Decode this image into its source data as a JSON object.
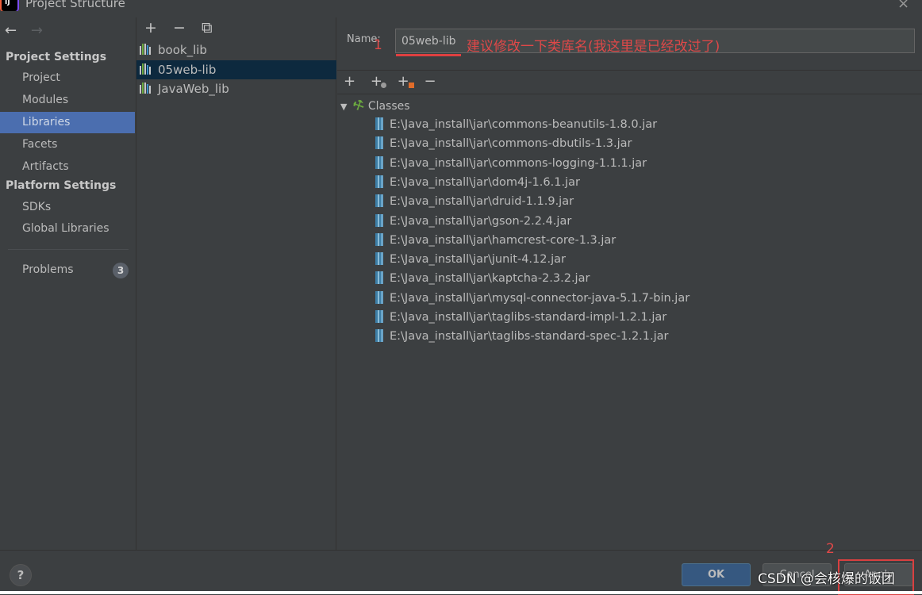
{
  "window": {
    "title": "Project Structure",
    "close_icon": "×"
  },
  "sidebar": {
    "back_icon": "←",
    "forward_icon": "→",
    "sections": [
      {
        "header": "Project Settings",
        "items": [
          "Project",
          "Modules",
          "Libraries",
          "Facets",
          "Artifacts"
        ]
      },
      {
        "header": "Platform Settings",
        "items": [
          "SDKs",
          "Global Libraries"
        ]
      }
    ],
    "selected": "Libraries",
    "problems": {
      "label": "Problems",
      "count": "3"
    }
  },
  "libraries": {
    "toolbar": {
      "add": "+",
      "remove": "−",
      "copy": "⧉"
    },
    "items": [
      "book_lib",
      "05web-lib",
      "JavaWeb_lib"
    ],
    "selected": "05web-lib"
  },
  "details": {
    "name_label": "Name:",
    "name_value": "05web-lib",
    "toolbar": {
      "add": "+",
      "add_url": "+",
      "add_module": "+",
      "remove": "−"
    },
    "tree_root": "Classes",
    "jars": [
      "E:\\Java_install\\jar\\commons-beanutils-1.8.0.jar",
      "E:\\Java_install\\jar\\commons-dbutils-1.3.jar",
      "E:\\Java_install\\jar\\commons-logging-1.1.1.jar",
      "E:\\Java_install\\jar\\dom4j-1.6.1.jar",
      "E:\\Java_install\\jar\\druid-1.1.9.jar",
      "E:\\Java_install\\jar\\gson-2.2.4.jar",
      "E:\\Java_install\\jar\\hamcrest-core-1.3.jar",
      "E:\\Java_install\\jar\\junit-4.12.jar",
      "E:\\Java_install\\jar\\kaptcha-2.3.2.jar",
      "E:\\Java_install\\jar\\mysql-connector-java-5.1.7-bin.jar",
      "E:\\Java_install\\jar\\taglibs-standard-impl-1.2.1.jar",
      "E:\\Java_install\\jar\\taglibs-standard-spec-1.2.1.jar"
    ]
  },
  "annotations": {
    "marker1": "1",
    "note1": "建议修改一下类库名(我这里是已经改过了)",
    "marker2": "2",
    "watermark": "CSDN @会核爆的饭团",
    "color": "#e04848"
  },
  "footer": {
    "help": "?",
    "ok": "OK",
    "cancel": "Cancel",
    "apply": "Apply"
  }
}
